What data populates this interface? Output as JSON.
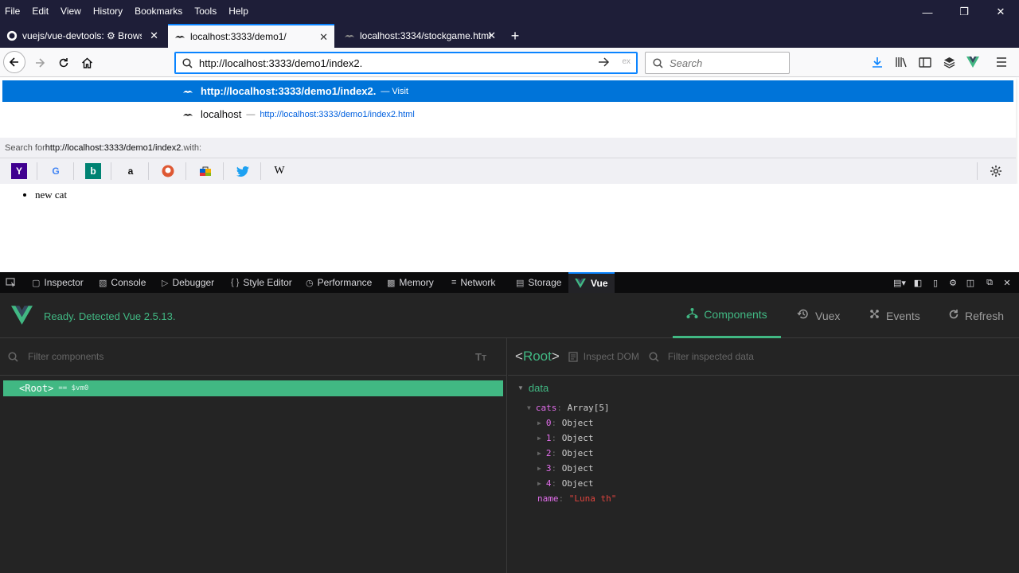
{
  "menu": [
    "File",
    "Edit",
    "View",
    "History",
    "Bookmarks",
    "Tools",
    "Help"
  ],
  "tabs": [
    {
      "label": "vuejs/vue-devtools: ⚙ Browse",
      "active": false
    },
    {
      "label": "localhost:3333/demo1/",
      "active": true
    },
    {
      "label": "localhost:3334/stockgame.html",
      "active": false
    }
  ],
  "urlbar": {
    "value": "http://localhost:3333/demo1/index2.",
    "hint": "ex"
  },
  "searchbar": {
    "placeholder": "Search"
  },
  "dropdown": {
    "selected": {
      "url": "http://localhost:3333/demo1/index2.",
      "action": "— Visit"
    },
    "second": {
      "title": "localhost",
      "sep": "—",
      "url": "http://localhost:3333/demo1/index2.html"
    },
    "search_prefix": "Search for ",
    "search_term": "http://localhost:3333/demo1/index2.",
    "search_suffix": " with:"
  },
  "page": {
    "items": [
      "new cat"
    ]
  },
  "devtools": {
    "tabs": [
      "Inspector",
      "Console",
      "Debugger",
      "Style Editor",
      "Performance",
      "Memory",
      "Network",
      "Storage",
      "Vue"
    ]
  },
  "vue": {
    "status": "Ready. Detected Vue 2.5.13.",
    "nav": [
      "Components",
      "Vuex",
      "Events",
      "Refresh"
    ],
    "filter_components": "Filter components",
    "root_tag": "<Root>",
    "root_vm": "== $vm0",
    "selected_title": "<Root>",
    "inspect_dom": "Inspect DOM",
    "filter_data": "Filter inspected data",
    "data_label": "data",
    "cats_key": "cats",
    "cats_value": "Array[5]",
    "cat_items": [
      {
        "key": "0",
        "value": "Object"
      },
      {
        "key": "1",
        "value": "Object"
      },
      {
        "key": "2",
        "value": "Object"
      },
      {
        "key": "3",
        "value": "Object"
      },
      {
        "key": "4",
        "value": "Object"
      }
    ],
    "name_key": "name",
    "name_value": "\"Luna th\""
  },
  "colors": {
    "vue_green": "#41b883",
    "chrome_dark": "#1e1e38",
    "accent_blue": "#0a84ff"
  }
}
